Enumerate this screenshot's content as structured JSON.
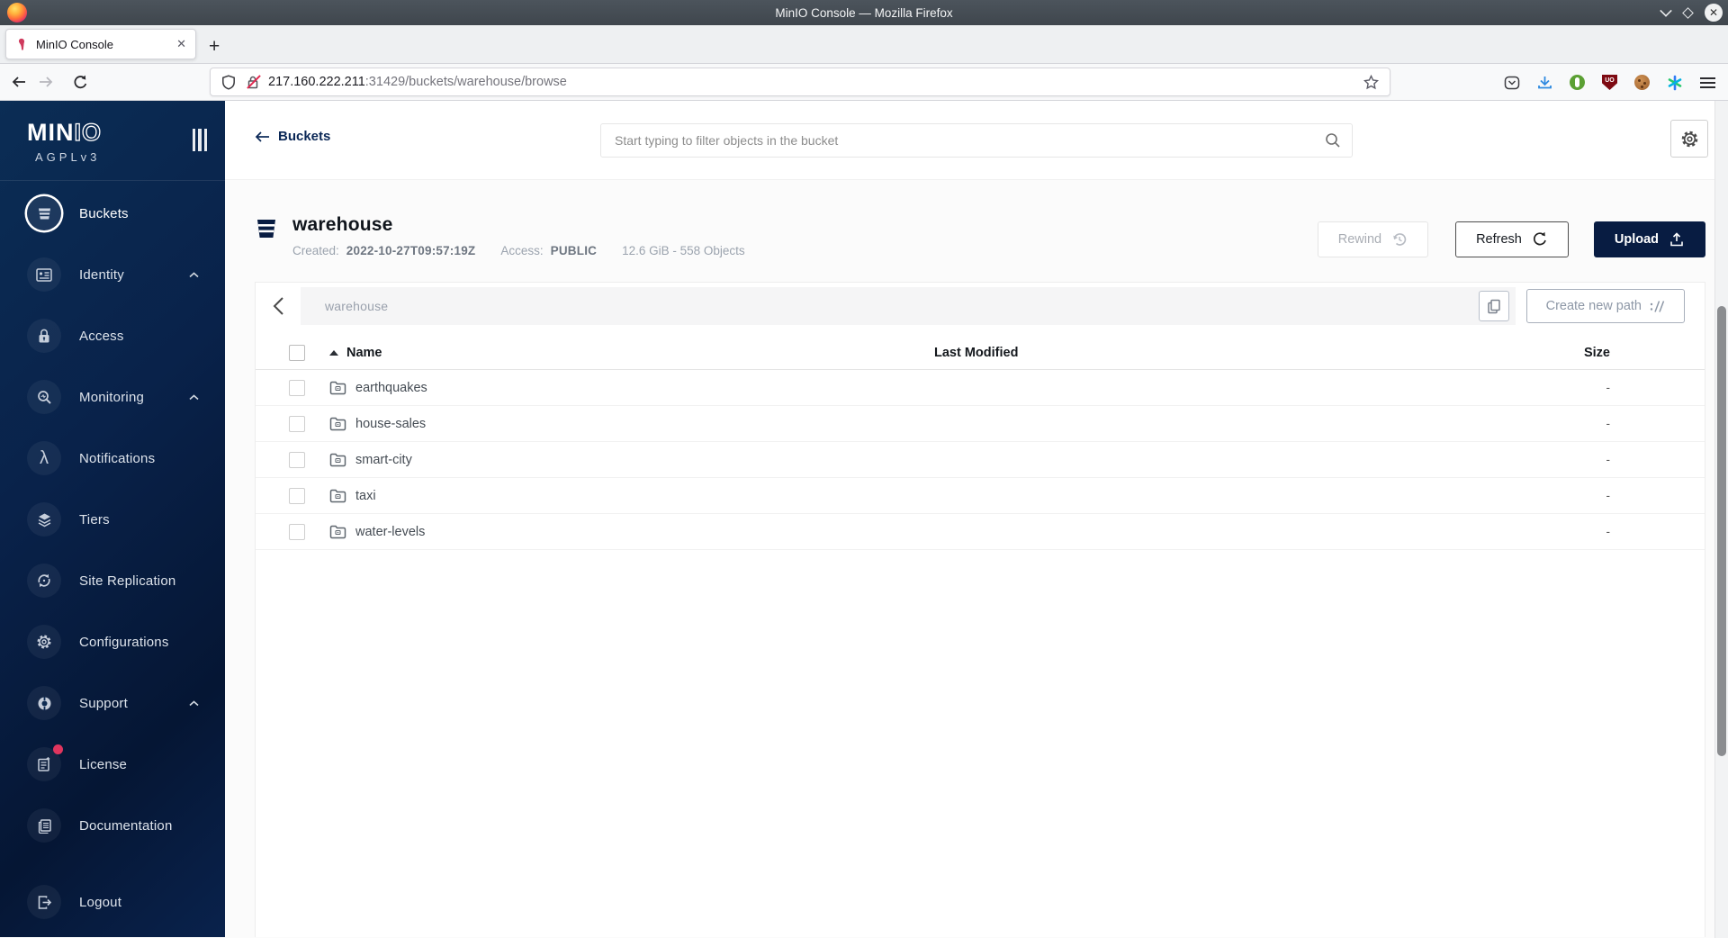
{
  "titlebar": {
    "title": "MinIO Console — Mozilla Firefox"
  },
  "browser": {
    "tab_title": "MinIO Console",
    "tab_close": "✕",
    "new_tab_label": "+",
    "url_host": "217.160.222.211",
    "url_rest": ":31429/buckets/warehouse/browse"
  },
  "sidebar": {
    "logo_solid": "MIN",
    "logo_outline": "IO",
    "license_tag": "AGPLv3",
    "items": [
      {
        "label": "Buckets"
      },
      {
        "label": "Identity"
      },
      {
        "label": "Access"
      },
      {
        "label": "Monitoring"
      },
      {
        "label": "Notifications"
      },
      {
        "label": "Tiers"
      },
      {
        "label": "Site Replication"
      },
      {
        "label": "Configurations"
      },
      {
        "label": "Support"
      },
      {
        "label": "License"
      },
      {
        "label": "Documentation"
      },
      {
        "label": "Logout"
      }
    ],
    "lambda_glyph": "λ"
  },
  "header": {
    "back_label": "Buckets",
    "search_placeholder": "Start typing to filter objects in the bucket"
  },
  "bucket": {
    "name": "warehouse",
    "created_label": "Created:",
    "created_value": "2022-10-27T09:57:19Z",
    "access_label": "Access:",
    "access_value": "PUBLIC",
    "summary": "12.6 GiB - 558 Objects",
    "rewind_label": "Rewind",
    "refresh_label": "Refresh",
    "upload_label": "Upload"
  },
  "browse": {
    "current_path": "warehouse",
    "create_path_label": "Create new path",
    "columns": {
      "name": "Name",
      "last_modified": "Last Modified",
      "size": "Size"
    },
    "rows": [
      {
        "name": "earthquakes",
        "size": "-"
      },
      {
        "name": "house-sales",
        "size": "-"
      },
      {
        "name": "smart-city",
        "size": "-"
      },
      {
        "name": "taxi",
        "size": "-"
      },
      {
        "name": "water-levels",
        "size": "-"
      }
    ]
  },
  "colors": {
    "sidebar_navy_top": "#0b2d55",
    "sidebar_navy_bottom": "#051634",
    "primary_navy": "#081c42",
    "badge_red": "#e0355e",
    "download_blue": "#2f8ae0",
    "ublock_red": "#7e0a12",
    "badger_green": "#5ba033"
  }
}
